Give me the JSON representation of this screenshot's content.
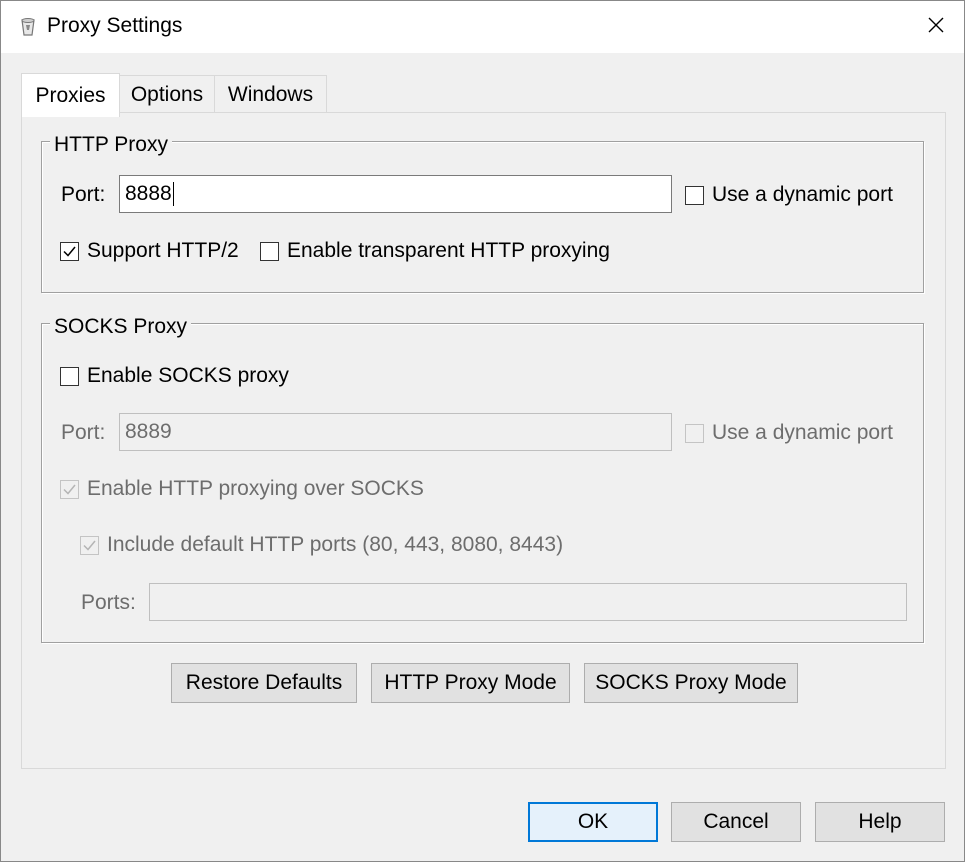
{
  "window": {
    "title": "Proxy Settings",
    "icon": "app-icon",
    "close_icon": "close-icon"
  },
  "tabs": [
    {
      "label": "Proxies",
      "active": true
    },
    {
      "label": "Options",
      "active": false
    },
    {
      "label": "Windows",
      "active": false
    }
  ],
  "http_proxy": {
    "group_title": "HTTP Proxy",
    "port_label": "Port:",
    "port_value": "8888",
    "dynamic_port_label": "Use a dynamic port",
    "dynamic_port_checked": false,
    "http2_label": "Support HTTP/2",
    "http2_checked": true,
    "transparent_label": "Enable transparent HTTP proxying",
    "transparent_checked": false
  },
  "socks_proxy": {
    "group_title": "SOCKS Proxy",
    "enable_label": "Enable SOCKS proxy",
    "enable_checked": false,
    "port_label": "Port:",
    "port_value": "8889",
    "dynamic_port_label": "Use a dynamic port",
    "dynamic_port_checked": false,
    "http_over_socks_label": "Enable HTTP proxying over SOCKS",
    "http_over_socks_checked": true,
    "default_ports_label": "Include default HTTP ports (80, 443, 8080, 8443)",
    "default_ports_checked": true,
    "ports_label": "Ports:",
    "ports_value": ""
  },
  "panel_buttons": {
    "restore_defaults": "Restore Defaults",
    "http_proxy_mode": "HTTP Proxy Mode",
    "socks_proxy_mode": "SOCKS Proxy Mode"
  },
  "dialog_buttons": {
    "ok": "OK",
    "cancel": "Cancel",
    "help": "Help"
  },
  "colors": {
    "default_button_border": "#0078d7",
    "disabled_text": "#6d6d6d"
  }
}
